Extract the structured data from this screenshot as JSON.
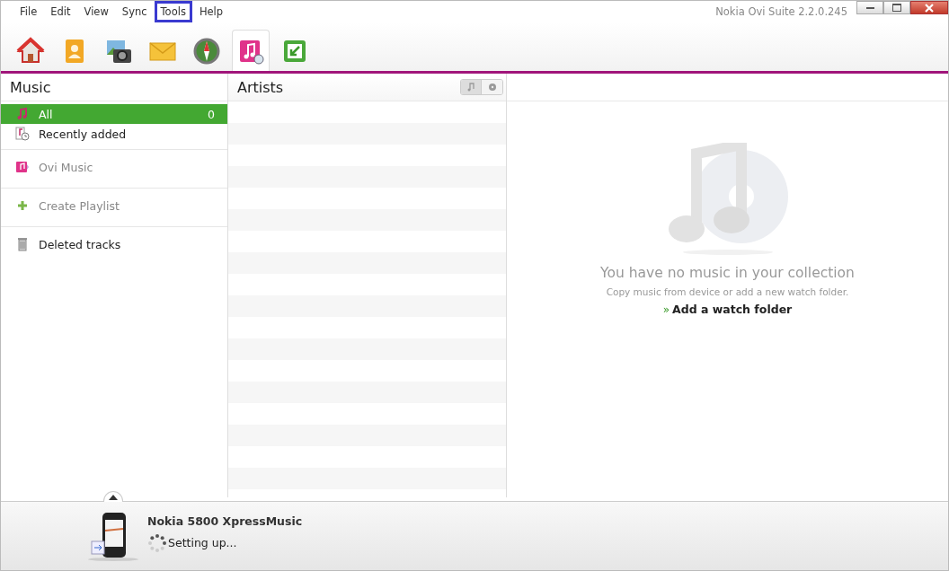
{
  "menu": [
    {
      "label": "File",
      "highlighted": false
    },
    {
      "label": "Edit",
      "highlighted": false
    },
    {
      "label": "View",
      "highlighted": false
    },
    {
      "label": "Sync",
      "highlighted": false
    },
    {
      "label": "Tools",
      "highlighted": true
    },
    {
      "label": "Help",
      "highlighted": false
    }
  ],
  "window": {
    "title": "Nokia Ovi Suite 2.2.0.245"
  },
  "toolbar": [
    {
      "kind": "home",
      "selected": false
    },
    {
      "kind": "contacts",
      "selected": false
    },
    {
      "kind": "photos",
      "selected": false
    },
    {
      "kind": "mail",
      "selected": false
    },
    {
      "kind": "compass",
      "selected": false
    },
    {
      "kind": "music",
      "selected": true
    },
    {
      "kind": "sync",
      "selected": false
    }
  ],
  "sidebar": {
    "title": "Music",
    "items": [
      {
        "kind": "note",
        "label": "All",
        "count": "0",
        "selected": true,
        "disabled": false,
        "divider_above": false
      },
      {
        "kind": "recent",
        "label": "Recently added",
        "selected": false,
        "disabled": false,
        "divider_above": false
      },
      {
        "kind": "store",
        "label": "Ovi Music",
        "selected": false,
        "disabled": true,
        "divider_above": true
      },
      {
        "kind": "plus",
        "label": "Create Playlist",
        "selected": false,
        "disabled": true,
        "divider_above": true
      },
      {
        "kind": "trash",
        "label": "Deleted tracks",
        "selected": false,
        "disabled": false,
        "divider_above": true
      }
    ]
  },
  "list": {
    "title": "Artists"
  },
  "empty": {
    "heading": "You have no music in your collection",
    "hint": "Copy music from device or add a new watch folder.",
    "link_mark": "»",
    "link": "Add a watch folder"
  },
  "device": {
    "name": "Nokia 5800 XpressMusic",
    "status": "Setting up..."
  }
}
